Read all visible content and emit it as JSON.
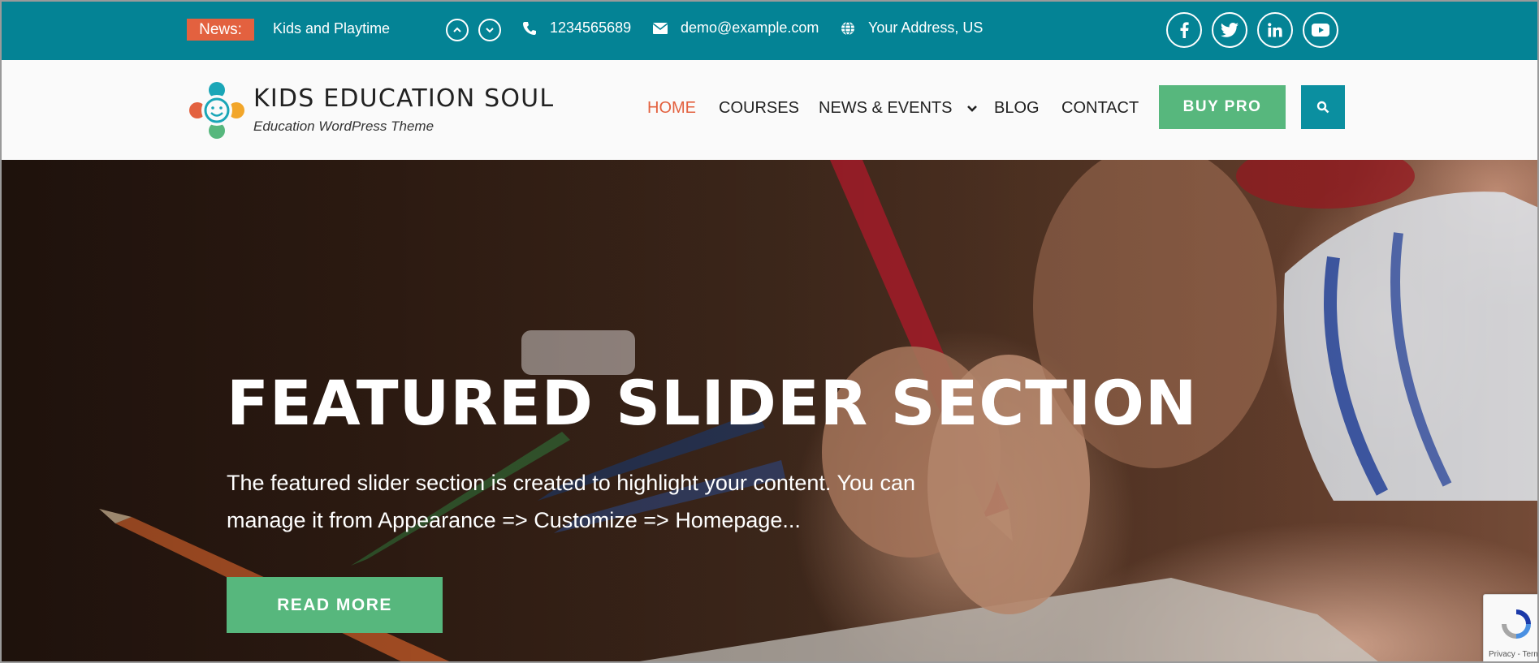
{
  "topbar": {
    "news_label": "News:",
    "news_text": "Kids and Playtime",
    "phone": "1234565689",
    "email": "demo@example.com",
    "address": "Your Address, US",
    "icons": [
      "chevron-up-icon",
      "chevron-down-icon",
      "phone-icon",
      "envelope-icon",
      "globe-icon"
    ],
    "social": [
      "facebook-icon",
      "twitter-icon",
      "linkedin-icon",
      "youtube-icon"
    ],
    "colors": {
      "background": "#048395",
      "badge": "#e3613f"
    }
  },
  "header": {
    "site_title": "KIDS EDUCATION SOUL",
    "tagline": "Education WordPress Theme",
    "nav": [
      {
        "label": "HOME",
        "active": true
      },
      {
        "label": "COURSES"
      },
      {
        "label": "NEWS & EVENTS",
        "has_dropdown": true
      },
      {
        "label": "BLOG"
      },
      {
        "label": "CONTACT"
      }
    ],
    "buy_pro_label": "BUY PRO",
    "colors": {
      "active": "#e3613f",
      "buy_pro": "#57b77d",
      "search": "#0b8fa0"
    }
  },
  "hero": {
    "title": "FEATURED SLIDER SECTION",
    "description": "The featured slider section is created to highlight your content. You can manage it from Appearance => Customize => Homepage...",
    "read_more_label": "READ MORE"
  },
  "recaptcha": {
    "text": "Privacy - Terms"
  }
}
